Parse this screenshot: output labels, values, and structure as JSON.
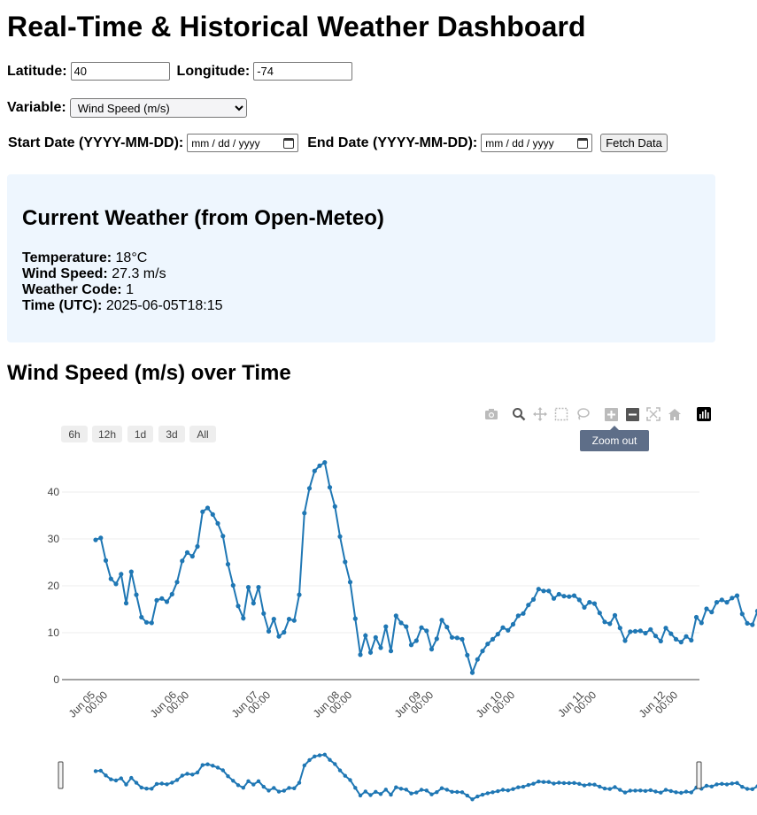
{
  "page": {
    "title": "Real-Time & Historical Weather Dashboard"
  },
  "form": {
    "latitude_label": "Latitude:",
    "latitude_value": "40",
    "longitude_label": "Longitude:",
    "longitude_value": "-74",
    "variable_label": "Variable:",
    "variable_selected": "Wind Speed (m/s)",
    "start_label": "Start Date (YYYY-MM-DD):",
    "start_placeholder": "mm / dd / yyyy",
    "end_label": "End Date (YYYY-MM-DD):",
    "end_placeholder": "mm / dd / yyyy",
    "fetch_label": "Fetch Data"
  },
  "current": {
    "heading": "Current Weather (from Open-Meteo)",
    "temperature_label": "Temperature:",
    "temperature_value": "18°C",
    "wind_label": "Wind Speed:",
    "wind_value": "27.3 m/s",
    "code_label": "Weather Code:",
    "code_value": "1",
    "time_label": "Time (UTC):",
    "time_value": "2025-06-05T18:15"
  },
  "chart_heading": "Wind Speed (m/s) over Time",
  "modebar": {
    "icons": [
      "camera-icon",
      "zoom-icon",
      "pan-icon",
      "box-select-icon",
      "lasso-icon",
      "zoom-in-icon",
      "zoom-out-icon",
      "autoscale-icon",
      "home-icon",
      "plotly-logo-icon"
    ],
    "tooltip": "Zoom out"
  },
  "range_selector": {
    "buttons": [
      "6h",
      "12h",
      "1d",
      "3d",
      "All"
    ]
  },
  "colors": {
    "line": "#1f77b4",
    "panel_bg": "#eef6fe",
    "tooltip_bg": "#5e6e88"
  },
  "chart_data": {
    "type": "line",
    "title": "",
    "xlabel": "",
    "ylabel": "",
    "ylim": [
      0,
      48
    ],
    "yticks": [
      0,
      10,
      20,
      30,
      40
    ],
    "x_ticks": [
      {
        "day": 0,
        "line1": "Jun 05",
        "line2": "00:00"
      },
      {
        "day": 1,
        "line1": "Jun 06",
        "line2": "00:00"
      },
      {
        "day": 2,
        "line1": "Jun 07",
        "line2": "00:00"
      },
      {
        "day": 3,
        "line1": "Jun 08",
        "line2": "00:00"
      },
      {
        "day": 4,
        "line1": "Jun 09",
        "line2": "00:00"
      },
      {
        "day": 5,
        "line1": "Jun 10",
        "line2": "00:00"
      },
      {
        "day": 6,
        "line1": "Jun 11",
        "line2": "00:00"
      },
      {
        "day": 7,
        "line1": "Jun 12",
        "line2": "00:00"
      }
    ],
    "grid": true,
    "rangeslider": true,
    "x_day_start": 0,
    "x_hours_step": 1.5,
    "series": [
      {
        "values": [
          29.8,
          30.2,
          25.4,
          21.5,
          20.4,
          22.5,
          16.3,
          23.0,
          18.1,
          13.3,
          12.2,
          12.1,
          16.9,
          17.3,
          16.6,
          18.2,
          20.8,
          25.3,
          27.1,
          26.3,
          28.4,
          35.8,
          36.6,
          35.2,
          33.3,
          30.6,
          24.6,
          20.1,
          15.7,
          13.1,
          19.7,
          16.3,
          19.7,
          14.1,
          10.3,
          12.9,
          9.2,
          10.1,
          12.9,
          12.6,
          18.1,
          35.5,
          40.8,
          44.5,
          45.6,
          46.3,
          41.0,
          36.9,
          30.5,
          25.1,
          20.8,
          13.0,
          5.3,
          9.4,
          5.8,
          9.0,
          6.8,
          11.3,
          6.1,
          13.6,
          12.1,
          11.3,
          7.4,
          8.3,
          11.1,
          10.4,
          6.5,
          8.7,
          12.7,
          11.2,
          9.0,
          8.9,
          8.6,
          5.2,
          1.5,
          4.3,
          6.1,
          7.6,
          8.6,
          9.7,
          11.1,
          10.5,
          11.8,
          13.6,
          14.1,
          15.9,
          17.1,
          19.3,
          18.9,
          18.9,
          17.3,
          18.2,
          17.8,
          17.7,
          17.9,
          17.0,
          15.4,
          16.5,
          16.2,
          14.2,
          12.3,
          11.9,
          13.7,
          11.0,
          8.3,
          10.2,
          10.3,
          10.4,
          9.9,
          10.7,
          9.3,
          8.2,
          11.0,
          9.8,
          8.6,
          8.0,
          9.2,
          8.4,
          13.3,
          12.1,
          15.1,
          14.4,
          16.5,
          17.0,
          16.5,
          17.4,
          17.9,
          14.0,
          12.0,
          11.7,
          14.6,
          15.0,
          9.5,
          12.1,
          10.1,
          11.1,
          10.3,
          12.2,
          13.1,
          11.0,
          9.8,
          6.7,
          4.2,
          9.3,
          13.6,
          12.8,
          8.8,
          5.0,
          5.1,
          6.0,
          7.9,
          8.6,
          10.0,
          10.2,
          10.5,
          10.4,
          10.3,
          10.1,
          10.2,
          11.0,
          11.6,
          12.5,
          13.3,
          14.2,
          15.0,
          15.9,
          16.7,
          17.6,
          18.2,
          18.9,
          19.4,
          19.2,
          19.3,
          18.9,
          17.2,
          15.2
        ]
      }
    ]
  }
}
